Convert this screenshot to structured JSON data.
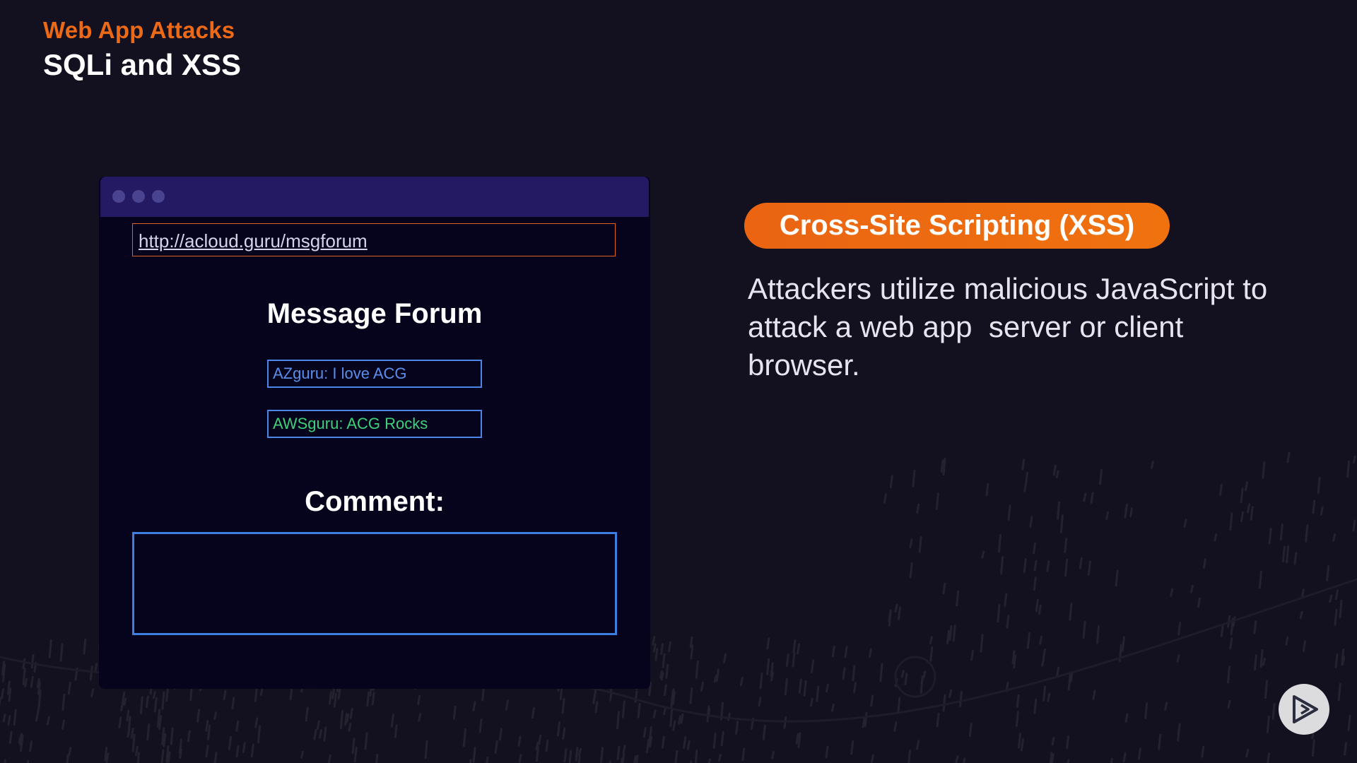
{
  "slide": {
    "eyebrow": "Web App Attacks",
    "title": "SQLi and XSS"
  },
  "browser": {
    "url": "http://acloud.guru/msgforum",
    "forum_title": "Message Forum",
    "messages": [
      {
        "text": "AZguru: I love ACG",
        "color": "#5b8eea"
      },
      {
        "text": "AWSguru: ACG Rocks",
        "color": "#3ed07a"
      }
    ],
    "comment_label": "Comment:",
    "comment_value": ""
  },
  "topic": {
    "pill_label": "Cross-Site Scripting (XSS)",
    "description": "Attackers utilize malicious JavaScript to\nattack a web app  server or client\nbrowser."
  },
  "controls": {
    "play_icon": "play-icon"
  },
  "colors": {
    "accent": "#ec6a17",
    "background": "#13111f",
    "browser_bar": "#241a63",
    "browser_body": "#05041c",
    "input_border": "#3c7fe0"
  }
}
